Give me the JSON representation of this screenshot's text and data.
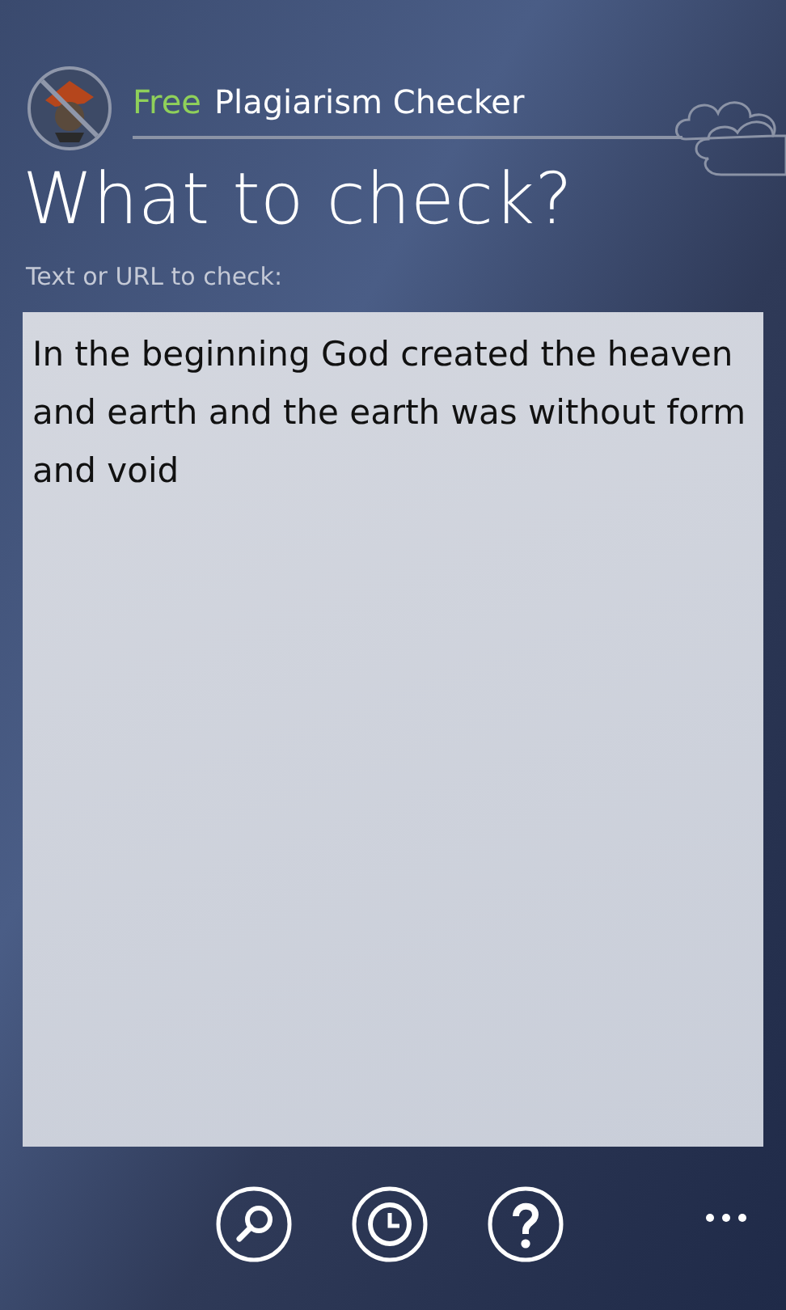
{
  "app_title": {
    "edition": "Free",
    "name": "Plagiarism Checker"
  },
  "heading": "What to check?",
  "input": {
    "label": "Text or URL to check:",
    "value": "In the beginning God created the heaven and earth and the earth was without form and void"
  },
  "app_bar": {
    "buttons": [
      {
        "kind": "search"
      },
      {
        "kind": "history"
      },
      {
        "kind": "help"
      }
    ]
  }
}
